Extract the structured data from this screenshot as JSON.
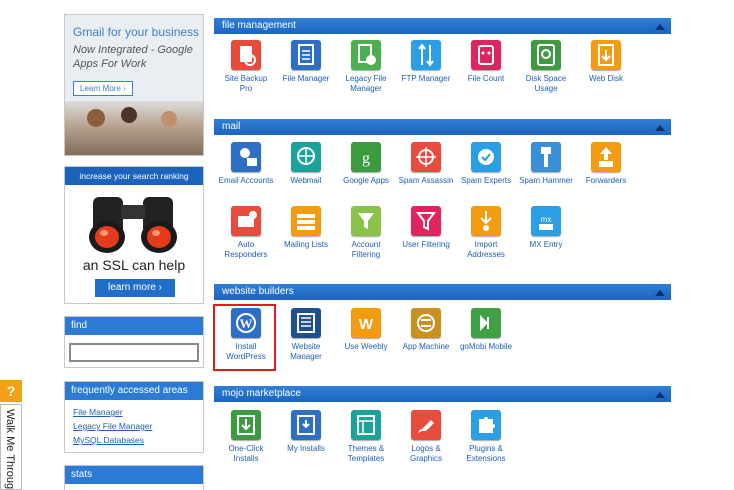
{
  "ads": {
    "gmail": {
      "title": "Gmail for your business",
      "tagline": "Now Integrated - Google Apps For Work",
      "button": "Learn More"
    },
    "ssl": {
      "header": "increase your search ranking",
      "text": "an SSL can help",
      "button": "learn more"
    }
  },
  "sidebar": {
    "find": {
      "title": "find",
      "value": ""
    },
    "frequent": {
      "title": "frequently accessed areas",
      "links": [
        "File Manager",
        "Legacy File Manager",
        "MySQL Databases"
      ]
    },
    "stats": {
      "title": "stats"
    }
  },
  "sections": [
    {
      "title": "file management",
      "items": [
        {
          "label": "Site Backup Pro",
          "icon": "site-backup-icon",
          "color": "#e64b3c"
        },
        {
          "label": "File Manager",
          "icon": "file-manager-icon",
          "color": "#2e6fc6"
        },
        {
          "label": "Legacy File Manager",
          "icon": "legacy-file-manager-icon",
          "color": "#4caf50"
        },
        {
          "label": "FTP Manager",
          "icon": "ftp-icon",
          "color": "#2b9fe6"
        },
        {
          "label": "File Count",
          "icon": "file-count-icon",
          "color": "#e0245e"
        },
        {
          "label": "Disk Space Usage",
          "icon": "disk-space-icon",
          "color": "#3f9a44"
        },
        {
          "label": "Web Disk",
          "icon": "web-disk-icon",
          "color": "#f39c12"
        }
      ]
    },
    {
      "title": "mail",
      "items": [
        {
          "label": "Email Accounts",
          "icon": "email-accounts-icon",
          "color": "#2e6fc6"
        },
        {
          "label": "Webmail",
          "icon": "webmail-icon",
          "color": "#1aa39a"
        },
        {
          "label": "Google Apps",
          "icon": "google-apps-icon",
          "color": "#3a9b3f"
        },
        {
          "label": "Spam Assassin",
          "icon": "spam-assassin-icon",
          "color": "#e74c3c"
        },
        {
          "label": "Spam Experts",
          "icon": "spam-experts-icon",
          "color": "#2b9fe6"
        },
        {
          "label": "Spam Hammer",
          "icon": "spam-hammer-icon",
          "color": "#3b8fd6"
        },
        {
          "label": "Forwarders",
          "icon": "forwarders-icon",
          "color": "#f39c12"
        },
        {
          "label": "Auto Responders",
          "icon": "auto-responders-icon",
          "color": "#e74c3c"
        },
        {
          "label": "Mailing Lists",
          "icon": "mailing-lists-icon",
          "color": "#f39c12"
        },
        {
          "label": "Account Filtering",
          "icon": "account-filtering-icon",
          "color": "#8bc34a"
        },
        {
          "label": "User Filtering",
          "icon": "user-filtering-icon",
          "color": "#e0245e"
        },
        {
          "label": "Import Addresses",
          "icon": "import-addresses-icon",
          "color": "#f39c12"
        },
        {
          "label": "MX Entry",
          "icon": "mx-entry-icon",
          "color": "#2b9fe6"
        }
      ]
    },
    {
      "title": "website builders",
      "items": [
        {
          "label": "Install WordPress",
          "icon": "wordpress-icon",
          "color": "#2e6fc6"
        },
        {
          "label": "Website Manager",
          "icon": "website-manager-icon",
          "color": "#1e4f8f"
        },
        {
          "label": "Use Weebly",
          "icon": "weebly-icon",
          "color": "#f39c12"
        },
        {
          "label": "App Machine",
          "icon": "app-machine-icon",
          "color": "#c89223"
        },
        {
          "label": "goMobi Mobile",
          "icon": "gomobi-icon",
          "color": "#3fa046"
        }
      ]
    },
    {
      "title": "mojo marketplace",
      "items": [
        {
          "label": "One-Click Installs",
          "icon": "one-click-installs-icon",
          "color": "#3a9b3f"
        },
        {
          "label": "My Installs",
          "icon": "my-installs-icon",
          "color": "#2e6fc6"
        },
        {
          "label": "Themes & Templates",
          "icon": "themes-templates-icon",
          "color": "#1aa39a"
        },
        {
          "label": "Logos & Graphics",
          "icon": "logos-graphics-icon",
          "color": "#e74c3c"
        },
        {
          "label": "Plugins & Extensions",
          "icon": "plugins-extensions-icon",
          "color": "#2b9fe6"
        }
      ]
    }
  ],
  "walkme": {
    "icon": "?",
    "label": "Walk Me Through"
  }
}
